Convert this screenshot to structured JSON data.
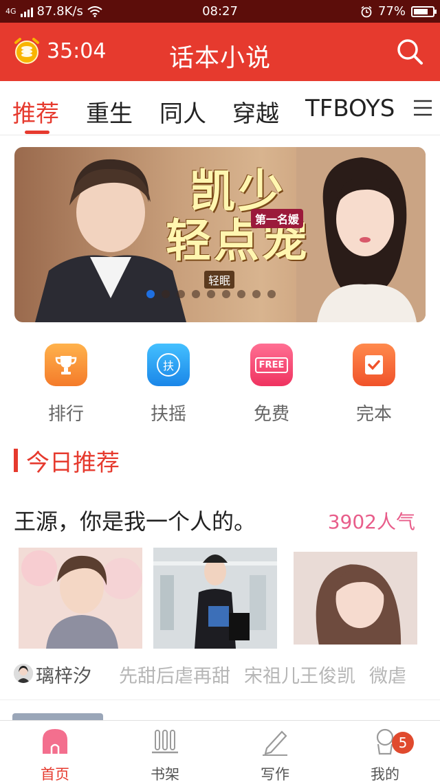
{
  "status_bar": {
    "network": "4G",
    "speed": "87.8K/s",
    "time": "08:27",
    "battery": "77%",
    "battery_level": 0.77
  },
  "app_bar": {
    "timer": "35:04",
    "title": "话本小说",
    "timer_icon": "alarm-coin-icon",
    "search_icon": "search-icon"
  },
  "tabs": [
    {
      "label": "推荐",
      "active": true
    },
    {
      "label": "重生",
      "active": false
    },
    {
      "label": "同人",
      "active": false
    },
    {
      "label": "穿越",
      "active": false
    },
    {
      "label": "TFBOYS",
      "active": false
    }
  ],
  "banner": {
    "title_line1": "凯少",
    "title_line2": "轻点宠",
    "tag": "第一名媛",
    "author": "轻眠",
    "page_count": 9,
    "active_page": 1
  },
  "entries": [
    {
      "label": "排行",
      "icon": "trophy-icon",
      "color": "#f7913a"
    },
    {
      "label": "扶摇",
      "icon": "fuyao-icon",
      "color": "#2aa3f0"
    },
    {
      "label": "免费",
      "icon": "free-icon",
      "color": "#f24c72"
    },
    {
      "label": "完本",
      "icon": "completed-icon",
      "color": "#f46a35"
    }
  ],
  "section": {
    "title": "今日推荐"
  },
  "feature": {
    "title": "王源，你是我一个人的。",
    "popularity": "3902人气",
    "author": "璃梓汐",
    "tags": [
      "先甜后虐再甜",
      "宋祖儿王俊凯",
      "微虐"
    ]
  },
  "bottom_nav": [
    {
      "label": "首页",
      "icon": "home-icon",
      "active": true
    },
    {
      "label": "书架",
      "icon": "bookshelf-icon",
      "active": false
    },
    {
      "label": "写作",
      "icon": "pen-icon",
      "active": false
    },
    {
      "label": "我的",
      "icon": "profile-icon",
      "active": false,
      "badge": "5"
    }
  ],
  "colors": {
    "brand": "#e63a2e",
    "status_bar": "#5c0d0a",
    "popularity": "#e85d8a"
  }
}
